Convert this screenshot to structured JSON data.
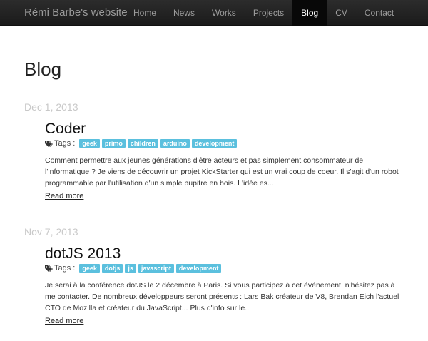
{
  "navbar": {
    "brand": "Rémi Barbe's website",
    "items": [
      {
        "label": "Home",
        "active": false
      },
      {
        "label": "News",
        "active": false
      },
      {
        "label": "Works",
        "active": false
      },
      {
        "label": "Projects",
        "active": false
      },
      {
        "label": "Blog",
        "active": true
      },
      {
        "label": "CV",
        "active": false
      },
      {
        "label": "Contact",
        "active": false
      }
    ],
    "colors": {
      "background": "#1b1b1b",
      "active_background": "#080808",
      "text": "#9d9d9d"
    }
  },
  "page": {
    "title": "Blog"
  },
  "tag_color": "#5bc0de",
  "posts": [
    {
      "date": "Dec 1, 2013",
      "title": "Coder",
      "tags_label": "Tags :",
      "tags": [
        "geek",
        "primo",
        "children",
        "arduino",
        "development"
      ],
      "excerpt": "Comment permettre aux jeunes générations d'être acteurs et pas simplement consommateur de l'informatique ? Je viens de découvrir un projet KickStarter qui est un vrai coup de coeur. Il s'agit d'un robot programmable par l'utilisation d'un simple pupitre en bois. L'idée es...",
      "read_more": "Read more"
    },
    {
      "date": "Nov 7, 2013",
      "title": "dotJS 2013",
      "tags_label": "Tags :",
      "tags": [
        "geek",
        "dotjs",
        "js",
        "javascript",
        "development"
      ],
      "excerpt": "Je serai à la conférence dotJS le 2 décembre à Paris. Si vous participez à cet événement, n'hésitez pas à me contacter. De nombreux développeurs seront présents : Lars Bak créateur de V8, Brendan Eich l'actuel CTO de Mozilla et créateur du JavaScript... Plus d'info sur le...",
      "read_more": "Read more"
    }
  ]
}
